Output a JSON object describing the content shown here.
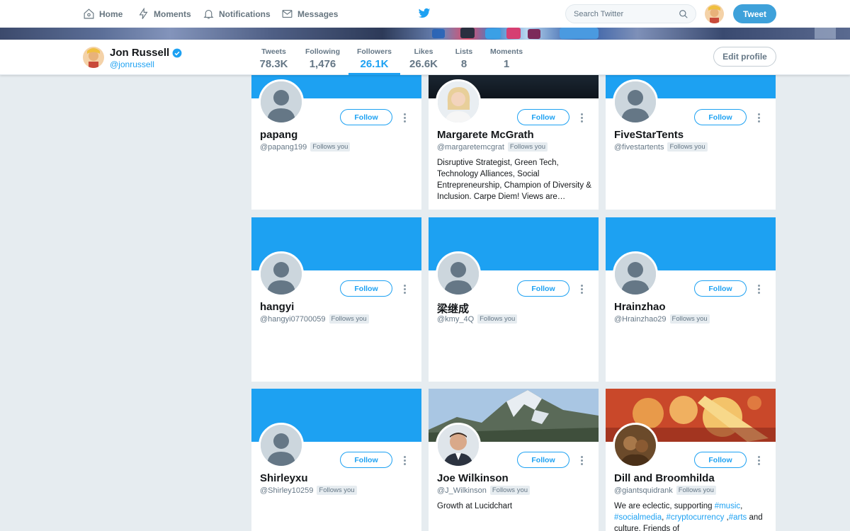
{
  "topnav": {
    "items": [
      {
        "label": "Home",
        "icon": "home-icon"
      },
      {
        "label": "Moments",
        "icon": "lightning-icon"
      },
      {
        "label": "Notifications",
        "icon": "bell-icon"
      },
      {
        "label": "Messages",
        "icon": "envelope-icon"
      }
    ],
    "search_placeholder": "Search Twitter",
    "tweet_label": "Tweet"
  },
  "profile": {
    "name": "Jon Russell",
    "handle": "@jonrussell",
    "stats": [
      {
        "label": "Tweets",
        "value": "78.3K"
      },
      {
        "label": "Following",
        "value": "1,476"
      },
      {
        "label": "Followers",
        "value": "26.1K"
      },
      {
        "label": "Likes",
        "value": "26.6K"
      },
      {
        "label": "Lists",
        "value": "8"
      },
      {
        "label": "Moments",
        "value": "1"
      }
    ],
    "active_tab": "Followers",
    "edit_label": "Edit profile"
  },
  "colors": {
    "accent": "#1da1f2",
    "background": "#e6ecf0"
  },
  "cards": [
    {
      "name": "papang",
      "handle": "@papang199",
      "follows_you": "Follows you",
      "follow_label": "Follow",
      "bio": ""
    },
    {
      "name": "Margarete McGrath",
      "handle": "@margaretemcgrat",
      "follows_you": "Follows you",
      "follow_label": "Follow",
      "bio": "Disruptive Strategist, Green Tech, Technology Alliances, Social Entrepreneurship, Champion of Diversity & Inclusion. Carpe Diem! Views are…"
    },
    {
      "name": "FiveStarTents",
      "handle": "@fivestartents",
      "follows_you": "Follows you",
      "follow_label": "Follow",
      "bio": ""
    },
    {
      "name": "hangyi",
      "handle": "@hangyi07700059",
      "follows_you": "Follows you",
      "follow_label": "Follow",
      "bio": ""
    },
    {
      "name": "梁继成",
      "handle": "@kmy_4Q",
      "follows_you": "Follows you",
      "follow_label": "Follow",
      "bio": ""
    },
    {
      "name": "Hrainzhao",
      "handle": "@Hrainzhao29",
      "follows_you": "Follows you",
      "follow_label": "Follow",
      "bio": ""
    },
    {
      "name": "Shirleyxu",
      "handle": "@Shirley10259",
      "follows_you": "Follows you",
      "follow_label": "Follow",
      "bio": ""
    },
    {
      "name": "Joe Wilkinson",
      "handle": "@J_Wilkinson",
      "follows_you": "Follows you",
      "follow_label": "Follow",
      "bio": "Growth at Lucidchart"
    },
    {
      "name": "Dill and Broomhilda",
      "handle": "@giantsquidrank",
      "follows_you": "Follows you",
      "follow_label": "Follow",
      "bio_parts": [
        "We are eclectic, supporting ",
        "#music",
        ", ",
        "#socialmedia",
        ", ",
        "#cryptocurrency",
        " ,",
        "#arts",
        " and culture. Friends of"
      ]
    }
  ]
}
